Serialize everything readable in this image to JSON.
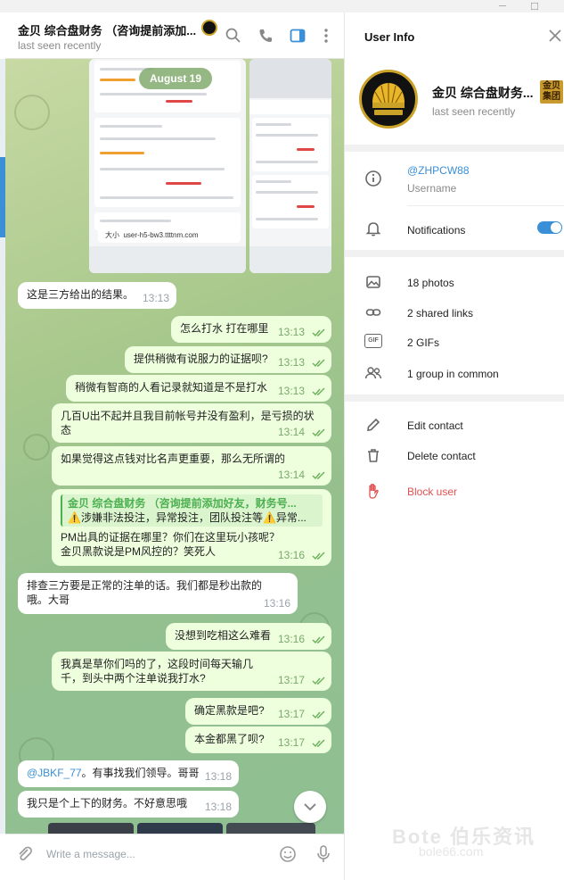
{
  "chat": {
    "title": "金贝 综合盘财务 （咨询提前添加...",
    "status": "last seen recently",
    "date_pill": "August 19",
    "composer_placeholder": "Write a message...",
    "screenshot": {
      "url": "user-h5-bw3.ttttnm.com",
      "size_label": "大小"
    },
    "messages": [
      {
        "text": "这是三方给出的结果。",
        "time": "13:13",
        "dir": "in"
      },
      {
        "text": "怎么打水 打在哪里",
        "time": "13:13",
        "dir": "out"
      },
      {
        "text": "提供稍微有说服力的证据呗?",
        "time": "13:13",
        "dir": "out"
      },
      {
        "text": "稍微有智商的人看记录就知道是不是打水",
        "time": "13:13",
        "dir": "out"
      },
      {
        "text": "几百U出不起并且我目前帐号并没有盈利，是亏损的状态",
        "time": "13:14",
        "dir": "out"
      },
      {
        "text": "如果觉得这点钱对比名声更重要，那么无所谓的",
        "time": "13:14",
        "dir": "out"
      },
      {
        "quote_name": "金贝 综合盘财务 （咨询提前添加好友，财务号...",
        "quote_text": "⚠️涉嫌非法投注，异常投注，团队投注等⚠️异常...",
        "text": "PM出具的证据在哪里？你们在这里玩小孩呢？金贝黑款说是PM风控的？笑死人",
        "time": "13:16",
        "dir": "out"
      },
      {
        "text": "排查三方要是正常的注单的话。我们都是秒出款的哦。大哥",
        "time": "13:16",
        "dir": "in"
      },
      {
        "text": "没想到吃相这么难看",
        "time": "13:16",
        "dir": "out"
      },
      {
        "text": "我真是草你们吗的了，这段时间每天输几千，到头中两个注单说我打水?",
        "time": "13:17",
        "dir": "out"
      },
      {
        "text": "确定黑款是吧?",
        "time": "13:17",
        "dir": "out"
      },
      {
        "text": "本金都黑了呗?",
        "time": "13:17",
        "dir": "out"
      },
      {
        "mention": "@JBKF_77",
        "text": "。有事找我们领导。哥哥",
        "time": "13:18",
        "dir": "in"
      },
      {
        "text": "我只是个上下的财务。不好意思哦",
        "time": "13:18",
        "dir": "in"
      }
    ]
  },
  "panel": {
    "title": "User Info",
    "name": "金贝 综合盘财务...",
    "status": "last seen recently",
    "badge": "金贝集团",
    "username": "@ZHPCW88",
    "username_label": "Username",
    "notifications": "Notifications",
    "photos": "18 photos",
    "links": "2 shared links",
    "gifs": "2 GIFs",
    "groups": "1 group in common",
    "edit": "Edit contact",
    "delete": "Delete contact",
    "block": "Block user",
    "gif_icon_text": "GIF"
  },
  "colors": {
    "accent": "#3a8fd6",
    "danger": "#e05050",
    "out_bubble": "#eeffde",
    "time_green": "#7aa86a"
  },
  "watermark": {
    "line1": "Bote 伯乐资讯",
    "line2": "bole66.com"
  }
}
